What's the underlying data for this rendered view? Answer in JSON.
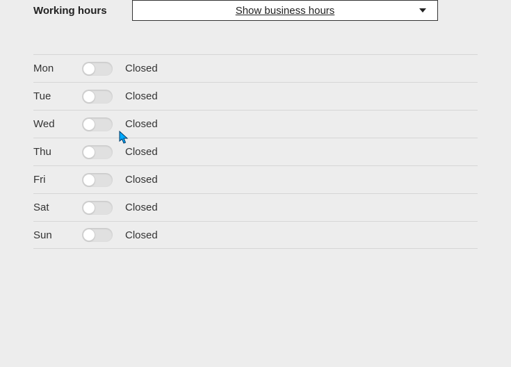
{
  "header": {
    "title": "Working hours",
    "dropdown": {
      "selected_label": "Show business hours"
    }
  },
  "days": [
    {
      "label": "Mon",
      "status": "Closed"
    },
    {
      "label": "Tue",
      "status": "Closed"
    },
    {
      "label": "Wed",
      "status": "Closed"
    },
    {
      "label": "Thu",
      "status": "Closed"
    },
    {
      "label": "Fri",
      "status": "Closed"
    },
    {
      "label": "Sat",
      "status": "Closed"
    },
    {
      "label": "Sun",
      "status": "Closed"
    }
  ]
}
